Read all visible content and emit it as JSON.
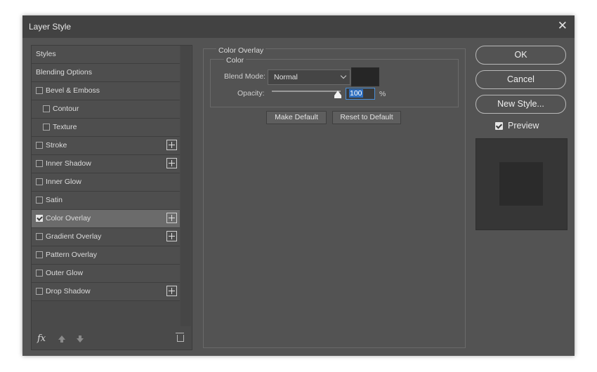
{
  "window": {
    "title": "Layer Style"
  },
  "styles_list": [
    {
      "label": "Styles",
      "checkbox": false,
      "indent": false,
      "plus": false
    },
    {
      "label": "Blending Options",
      "checkbox": false,
      "indent": false,
      "plus": false
    },
    {
      "label": "Bevel & Emboss",
      "checkbox": true,
      "checked": false,
      "indent": false,
      "plus": false
    },
    {
      "label": "Contour",
      "checkbox": true,
      "checked": false,
      "indent": true,
      "plus": false
    },
    {
      "label": "Texture",
      "checkbox": true,
      "checked": false,
      "indent": true,
      "plus": false
    },
    {
      "label": "Stroke",
      "checkbox": true,
      "checked": false,
      "indent": false,
      "plus": true
    },
    {
      "label": "Inner Shadow",
      "checkbox": true,
      "checked": false,
      "indent": false,
      "plus": true
    },
    {
      "label": "Inner Glow",
      "checkbox": true,
      "checked": false,
      "indent": false,
      "plus": false
    },
    {
      "label": "Satin",
      "checkbox": true,
      "checked": false,
      "indent": false,
      "plus": false
    },
    {
      "label": "Color Overlay",
      "checkbox": true,
      "checked": true,
      "indent": false,
      "plus": true,
      "selected": true
    },
    {
      "label": "Gradient Overlay",
      "checkbox": true,
      "checked": false,
      "indent": false,
      "plus": true
    },
    {
      "label": "Pattern Overlay",
      "checkbox": true,
      "checked": false,
      "indent": false,
      "plus": false
    },
    {
      "label": "Outer Glow",
      "checkbox": true,
      "checked": false,
      "indent": false,
      "plus": false
    },
    {
      "label": "Drop Shadow",
      "checkbox": true,
      "checked": false,
      "indent": false,
      "plus": true
    }
  ],
  "footer": {
    "fx_label": "fx"
  },
  "panel": {
    "group_title": "Color Overlay",
    "subgroup_title": "Color",
    "blend_mode_label": "Blend Mode:",
    "blend_mode_value": "Normal",
    "opacity_label": "Opacity:",
    "opacity_value": "100",
    "opacity_unit": "%",
    "overlay_color": "#262626",
    "make_default": "Make Default",
    "reset_default": "Reset to Default"
  },
  "actions": {
    "ok": "OK",
    "cancel": "Cancel",
    "new_style": "New Style...",
    "preview_label": "Preview",
    "preview_checked": true
  }
}
